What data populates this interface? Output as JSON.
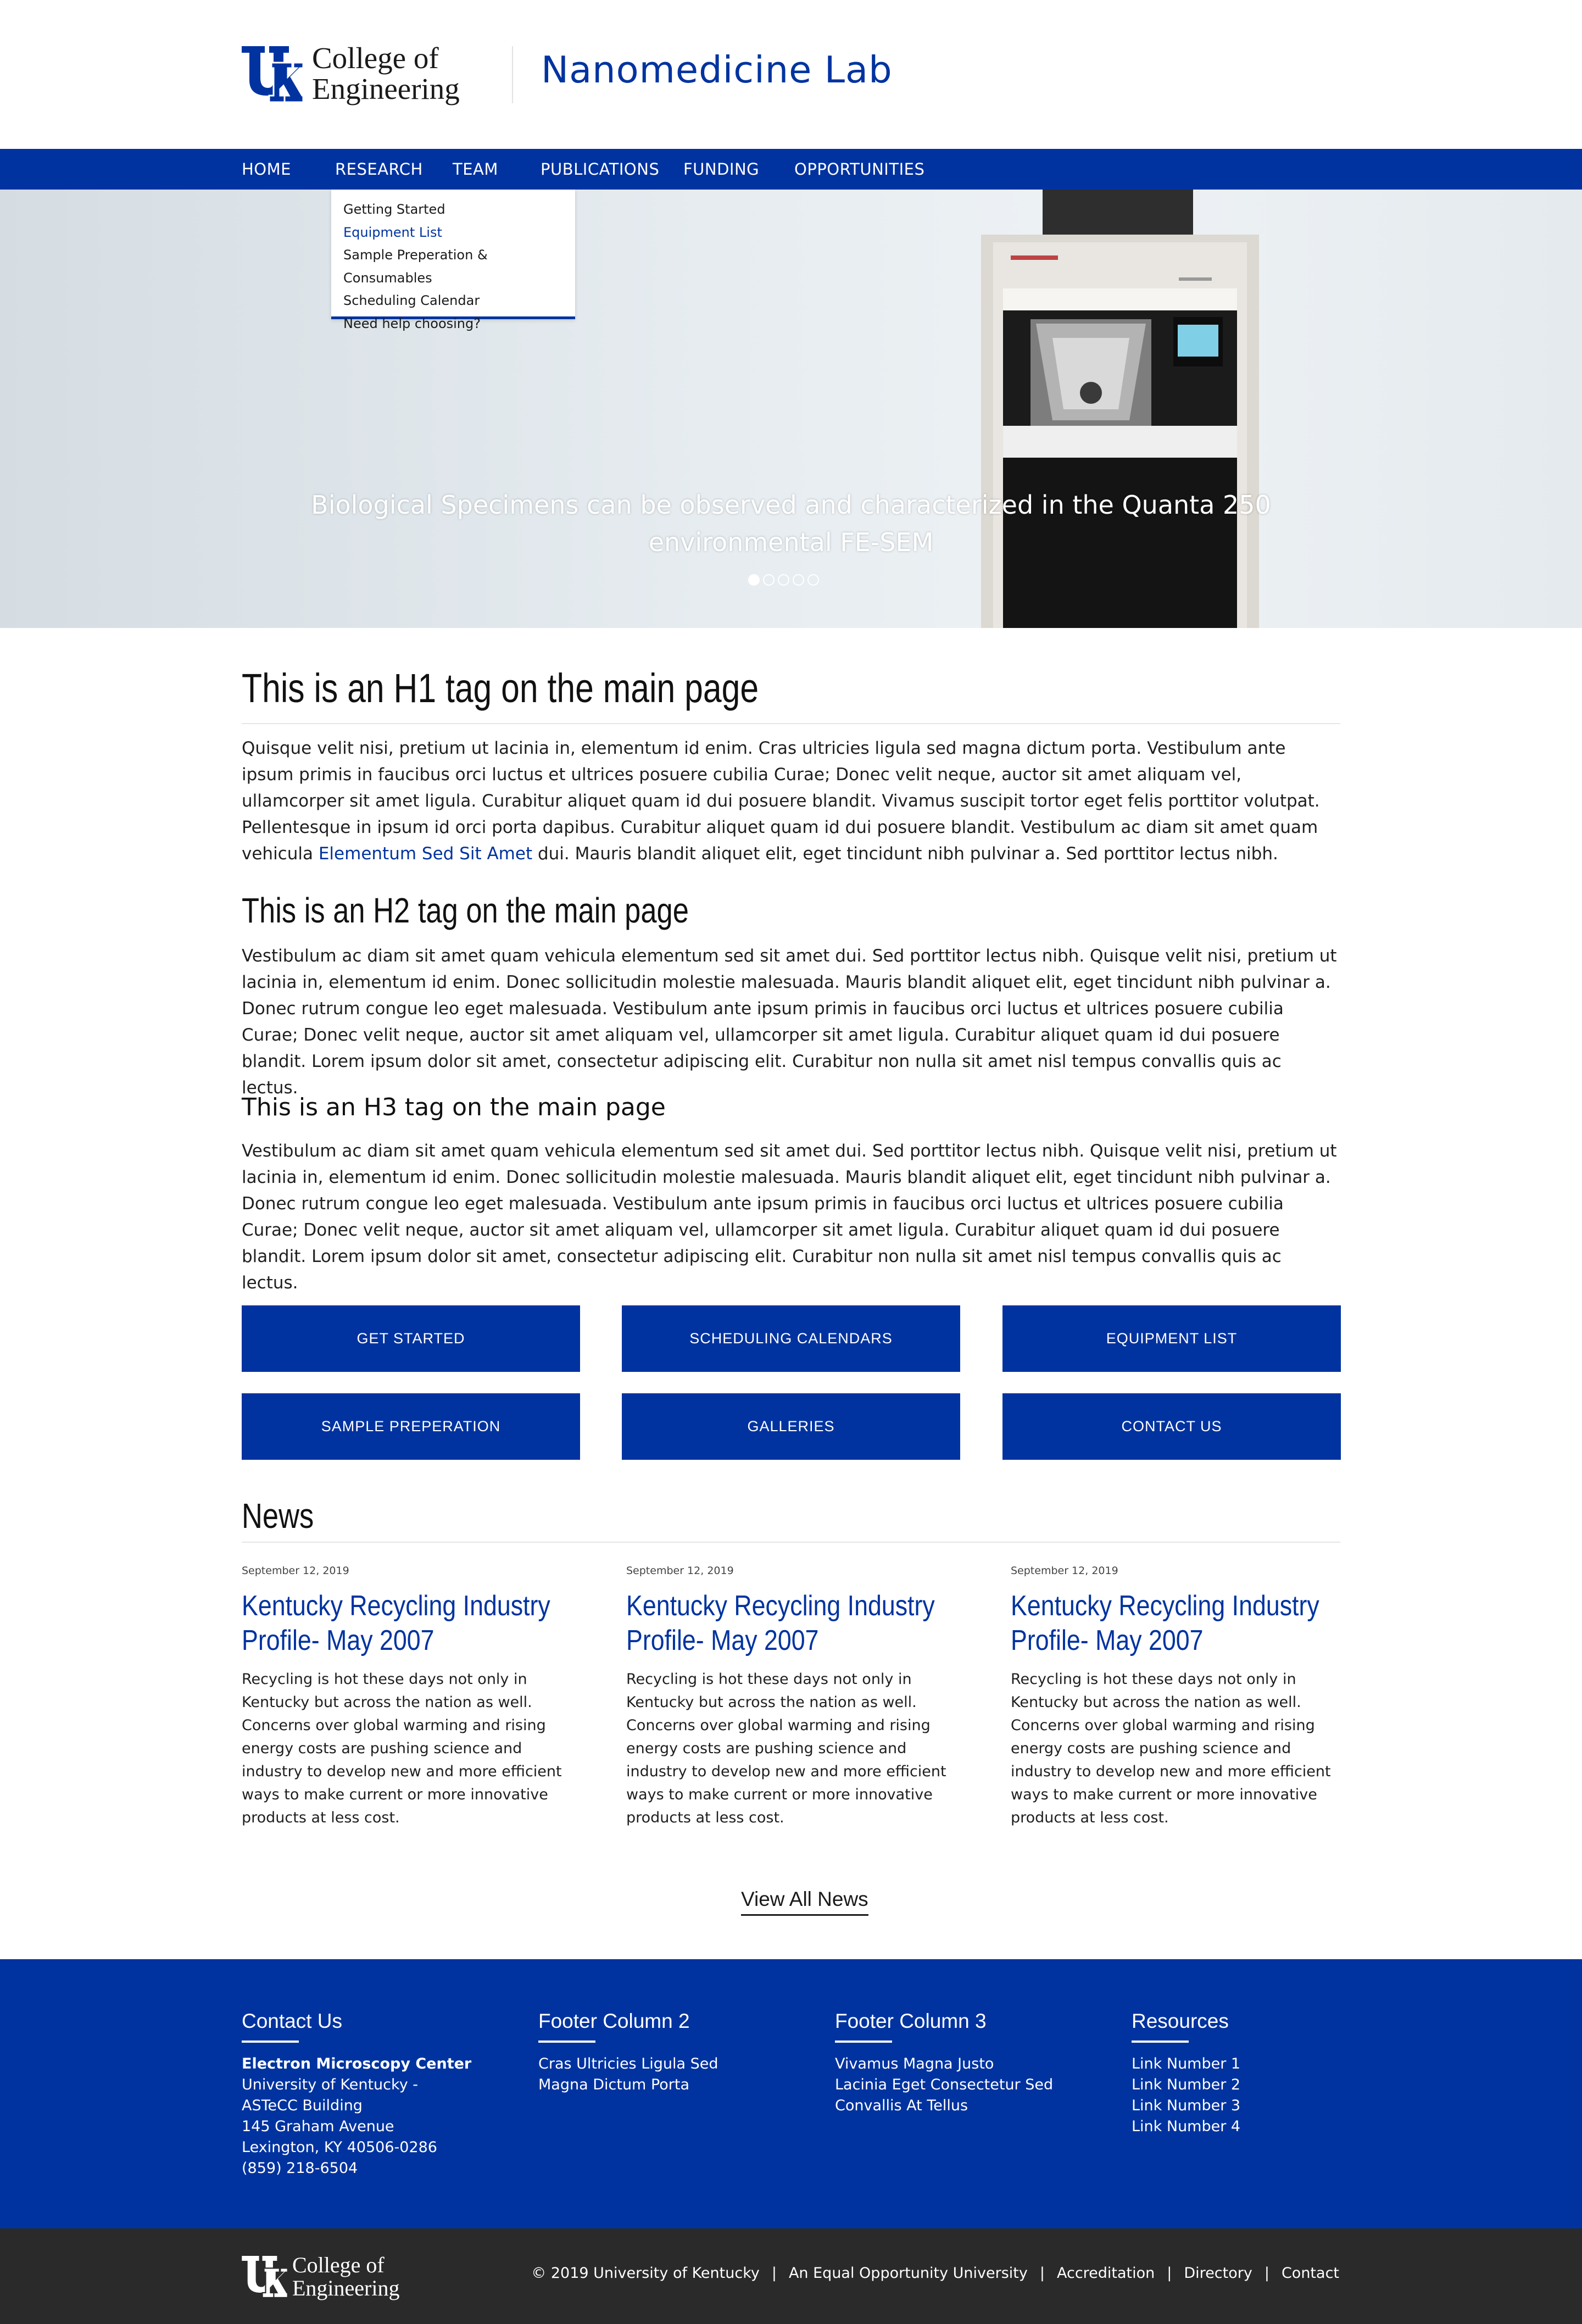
{
  "header": {
    "college_line1": "College of",
    "college_line2": "Engineering",
    "site_title": "Nanomedicine Lab"
  },
  "nav": {
    "items": [
      "HOME",
      "RESEARCH",
      "TEAM",
      "PUBLICATIONS",
      "FUNDING",
      "OPPORTUNITIES"
    ]
  },
  "dropdown": {
    "items": [
      "Getting Started",
      "Equipment List",
      "Sample Preperation & Consumables",
      "Scheduling Calendar",
      "Need help choosing?"
    ],
    "active": "Equipment List"
  },
  "hero": {
    "caption_line1": "Biological Specimens can be observed and characterized in the Quanta 250",
    "caption_line2": "environmental FE-SEM",
    "slide_count": 5,
    "active_slide": 1
  },
  "main": {
    "h1": "This is an H1 tag on the main page",
    "p1": "Quisque velit nisi, pretium ut lacinia in, elementum id enim. Cras ultricies ligula sed magna dictum porta. Vestibulum ante ipsum primis in faucibus orci luctus et ultrices posuere cubilia Curae; Donec velit neque, auctor sit amet aliquam vel, ullamcorper sit amet ligula. Curabitur aliquet quam id dui posuere blandit. Vivamus suscipit tortor eget felis porttitor volutpat. Pellentesque in ipsum id orci porta dapibus. Curabitur aliquet quam id dui posuere blandit. Vestibulum ac diam sit amet quam vehicula ",
    "p1_link": "Elementum Sed Sit Amet",
    "p1_tail": " dui. Mauris blandit aliquet elit, eget tincidunt nibh pulvinar a. Sed porttitor lectus nibh.",
    "h2": "This is an H2 tag on the main page",
    "p2": "Vestibulum ac diam sit amet quam vehicula elementum sed sit amet dui. Sed porttitor lectus nibh. Quisque velit nisi, pretium ut lacinia in, elementum id enim. Donec sollicitudin molestie malesuada. Mauris blandit aliquet elit, eget tincidunt nibh pulvinar a. Donec rutrum congue leo eget malesuada. Vestibulum ante ipsum primis in faucibus orci luctus et ultrices posuere cubilia Curae; Donec velit neque, auctor sit amet aliquam vel, ullamcorper sit amet ligula. Curabitur aliquet quam id dui posuere blandit. Lorem ipsum dolor sit amet, consectetur adipiscing elit. Curabitur non nulla sit amet nisl tempus convallis quis ac lectus.",
    "h3": "This is an H3 tag on the main page",
    "p3": "Vestibulum ac diam sit amet quam vehicula elementum sed sit amet dui. Sed porttitor lectus nibh. Quisque velit nisi, pretium ut lacinia in, elementum id enim. Donec sollicitudin molestie malesuada. Mauris blandit aliquet elit, eget tincidunt nibh pulvinar a. Donec rutrum congue leo eget malesuada. Vestibulum ante ipsum primis in faucibus orci luctus et ultrices posuere cubilia Curae; Donec velit neque, auctor sit amet aliquam vel, ullamcorper sit amet ligula. Curabitur aliquet quam id dui posuere blandit. Lorem ipsum dolor sit amet, consectetur adipiscing elit. Curabitur non nulla sit amet nisl tempus convallis quis ac lectus."
  },
  "buttons": [
    "GET STARTED",
    "SCHEDULING CALENDARS",
    "EQUIPMENT LIST",
    "SAMPLE PREPERATION",
    "GALLERIES",
    "CONTACT US"
  ],
  "news": {
    "title": "News",
    "items": [
      {
        "date": "September 12, 2019",
        "title": "Kentucky Recycling Industry Profile- May 2007",
        "body": "Recycling is hot these days not only in Kentucky but across the nation as well. Concerns over global warming and rising energy costs are pushing science and industry to develop new and more efficient ways to make current or more innovative products at less cost."
      },
      {
        "date": "September 12, 2019",
        "title": "Kentucky Recycling Industry Profile- May 2007",
        "body": "Recycling is hot these days not only in Kentucky but across the nation as well. Concerns over global warming and rising energy costs are pushing science and industry to develop new and more efficient ways to make current or more innovative products at less cost."
      },
      {
        "date": "September 12, 2019",
        "title": "Kentucky Recycling Industry Profile- May 2007",
        "body": "Recycling is hot these days not only in Kentucky but across the nation as well. Concerns over global warming and rising energy costs are pushing science and industry to develop new and more efficient ways to make current or more innovative products at less cost."
      }
    ],
    "view_all": "View All News"
  },
  "footer": {
    "columns": [
      {
        "title": "Contact Us",
        "bold_line": "Electron Microscopy Center",
        "lines": [
          "University of Kentucky -",
          "ASTeCC Building",
          "145 Graham Avenue",
          "Lexington, KY 40506-0286",
          "(859) 218-6504"
        ]
      },
      {
        "title": "Footer Column 2",
        "lines": [
          "Cras Ultricies Ligula Sed",
          "Magna Dictum Porta"
        ]
      },
      {
        "title": "Footer Column 3",
        "lines": [
          "Vivamus Magna Justo",
          "Lacinia Eget Consectetur Sed",
          "Convallis At Tellus"
        ]
      },
      {
        "title": "Resources",
        "lines": [
          "Link Number 1",
          "Link Number 2",
          "Link Number 3",
          "Link Number 4"
        ]
      }
    ],
    "bottom_links": [
      "© 2019 University of Kentucky",
      "An Equal Opportunity University",
      "Accreditation",
      "Directory",
      "Contact"
    ],
    "separator": "|"
  },
  "colors": {
    "brand_blue": "#0033a0",
    "footer_dark": "#2a2a2a"
  }
}
